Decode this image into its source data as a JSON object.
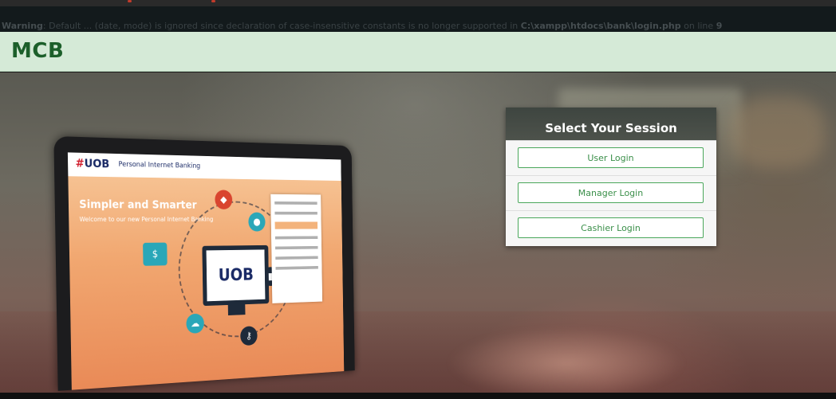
{
  "warning": {
    "label": "Warning",
    "message": ": Default ... (date, mode) is ignored since declaration of case-insensitive constants is no longer supported in",
    "path": "C:\\xampp\\htdocs\\bank\\login.php",
    "line_prefix": "on line",
    "line_no": "9"
  },
  "header": {
    "brand": "MCB"
  },
  "hero_screen": {
    "logo_mark": "#",
    "logo_text": "UOB",
    "app_label": "Personal Internet Banking",
    "headline": "Simpler and Smarter",
    "subline": "Welcome to our new Personal Internet Banking",
    "monitor_logo": "UOB"
  },
  "session": {
    "title": "Select Your Session",
    "buttons": [
      {
        "label": "User Login"
      },
      {
        "label": "Manager Login"
      },
      {
        "label": "Cashier Login"
      }
    ]
  },
  "colors": {
    "header_bg": "#d5ead7",
    "brand": "#1c5f2a",
    "button_border": "#4aa75b",
    "button_text": "#3a8f49"
  }
}
